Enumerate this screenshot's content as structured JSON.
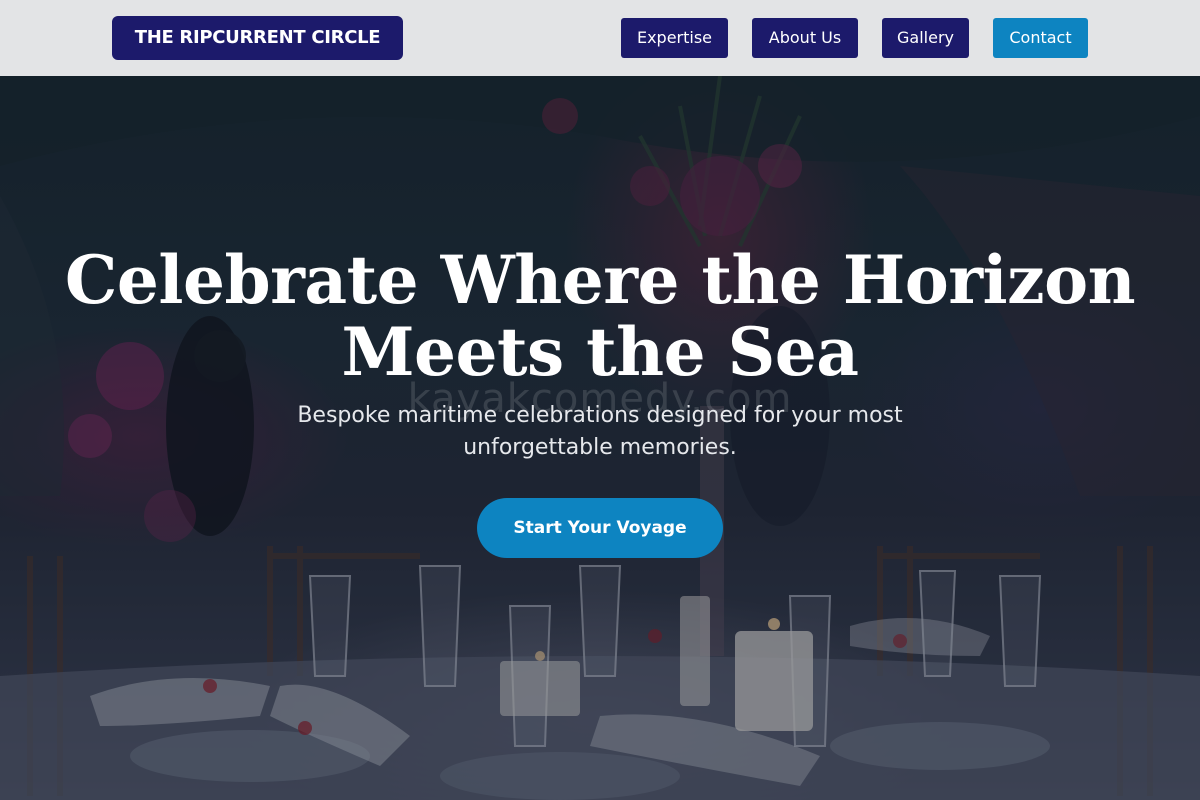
{
  "header": {
    "logo_text": "THE RIPCURRENT CIRCLE",
    "nav": [
      {
        "label": "Expertise"
      },
      {
        "label": "About Us"
      },
      {
        "label": "Gallery"
      },
      {
        "label": "Contact"
      }
    ]
  },
  "hero": {
    "title_line1": "Celebrate Where the Horizon",
    "title_line2": "Meets the Sea",
    "subtitle_line1": "Bespoke maritime celebrations designed for your most",
    "subtitle_line2": "unforgettable memories.",
    "cta_label": "Start Your Voyage",
    "watermark": "kayakcomedy.com"
  },
  "colors": {
    "header_bg": "#e3e4e6",
    "brand_navy": "#1c1a6b",
    "accent_blue": "#0d84c1",
    "text_white": "#ffffff"
  }
}
